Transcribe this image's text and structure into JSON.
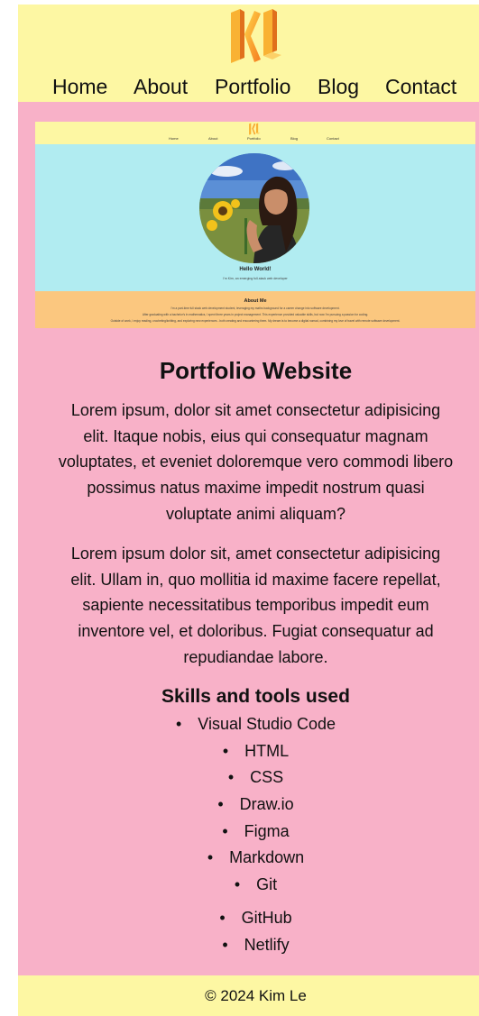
{
  "header": {
    "logo_text": "KL",
    "nav": [
      "Home",
      "About",
      "Portfolio",
      "Blog",
      "Contact"
    ]
  },
  "preview": {
    "logo_text": "KL",
    "nav": [
      "Home",
      "About",
      "Portfolio",
      "Blog",
      "Contact"
    ],
    "hello": "Hello World!",
    "subtitle": "I'm Kim, an emerging full-stack web developer",
    "about_title": "About Me",
    "about_lines": [
      "I'm a part-time full stack web development student, leveraging my maths background for a career change into software development.",
      "After graduating with a bachelor's in mathematics, I spent three years in project management. This experience provided valuable skills, but now I'm pursuing a passion for coding.",
      "Outside of work, I enjoy reading, crocheting/knitting, and exploring new experiences - both creating and encountering them. My dream is to become a digital nomad, combining my love of travel with remote software development."
    ]
  },
  "project": {
    "title": "Portfolio Website",
    "paragraph1_lines": [
      "Lorem ipsum, dolor sit amet consectetur adipisicing",
      "elit. Itaque nobis, eius qui consequatur magnam",
      "voluptates, et eveniet doloremque vero commodi libero",
      "possimus natus maxime impedit nostrum quasi",
      "voluptate animi aliquam?"
    ],
    "paragraph2_lines": [
      "Lorem ipsum dolor sit, amet consectetur adipisicing",
      "elit. Ullam in, quo mollitia id maxime facere repellat,",
      "sapiente necessitatibus temporibus impedit eum",
      "inventore vel, et doloribus. Fugiat consequatur ad",
      "repudiandae labore."
    ],
    "skills_title": "Skills and tools used",
    "skills": [
      "Visual Studio Code",
      "HTML",
      "CSS",
      "Draw.io",
      "Figma",
      "Markdown",
      "Git",
      "GitHub",
      "Netlify"
    ]
  },
  "footer": {
    "text": "© 2024 Kim Le"
  },
  "colors": {
    "header_bg": "#fdf7a3",
    "main_bg": "#f8b1c8",
    "preview_hero_bg": "#b1ecf1",
    "preview_about_bg": "#fbc77f",
    "logo_orange": "#f7a32e"
  }
}
